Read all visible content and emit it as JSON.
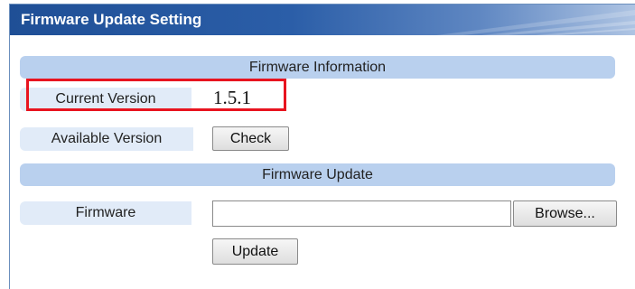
{
  "panel": {
    "title": "Firmware Update Setting"
  },
  "sections": {
    "info_title": "Firmware Information",
    "update_title": "Firmware Update"
  },
  "info": {
    "current_version_label": "Current Version",
    "current_version_value": "1.5.1",
    "available_version_label": "Available Version",
    "check_button": "Check"
  },
  "update": {
    "firmware_label": "Firmware",
    "file_value": "",
    "browse_button": "Browse...",
    "update_button": "Update"
  },
  "colors": {
    "header_dark": "#1f4f96",
    "section_bar": "#b9d0ee",
    "label_cell": "#e1ebf8",
    "highlight": "#e8141f"
  }
}
